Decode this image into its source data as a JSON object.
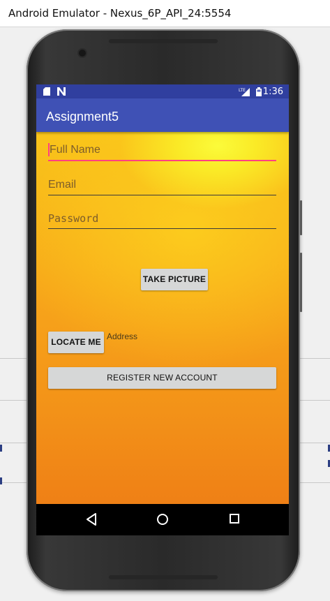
{
  "window": {
    "title": "Android Emulator - Nexus_6P_API_24:5554"
  },
  "status_bar": {
    "time": "1:36"
  },
  "app_bar": {
    "title": "Assignment5"
  },
  "form": {
    "full_name": {
      "placeholder": "Full Name",
      "value": ""
    },
    "email": {
      "placeholder": "Email",
      "value": ""
    },
    "password": {
      "placeholder": "Password",
      "value": ""
    },
    "take_picture_label": "TAKE PICTURE",
    "locate_me_label": "LOCATE ME",
    "address_label": "Address",
    "register_label": "REGISTER NEW ACCOUNT"
  },
  "colors": {
    "status_bar": "#303f9f",
    "app_bar": "#3f51b5",
    "accent": "#ff4081",
    "button": "#d6d7d7"
  },
  "icons": {
    "status_left": [
      "sd-card-icon",
      "n-notification-icon"
    ],
    "status_right": [
      "lte-signal-icon",
      "battery-icon"
    ],
    "nav": [
      "back-icon",
      "home-icon",
      "recents-icon"
    ]
  }
}
